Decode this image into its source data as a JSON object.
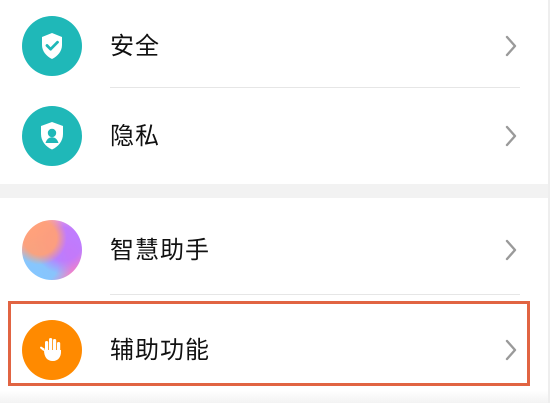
{
  "settings": {
    "items": [
      {
        "label": "安全",
        "icon": "shield-check-icon",
        "color": "#1fb8b8"
      },
      {
        "label": "隐私",
        "icon": "privacy-user-icon",
        "color": "#1fb8b8"
      },
      {
        "label": "智慧助手",
        "icon": "smart-assistant-icon",
        "color": "#c7a6ff"
      },
      {
        "label": "辅助功能",
        "icon": "hand-icon",
        "color": "#ff8a00"
      }
    ]
  },
  "ui": {
    "highlight_color": "#e16442"
  }
}
